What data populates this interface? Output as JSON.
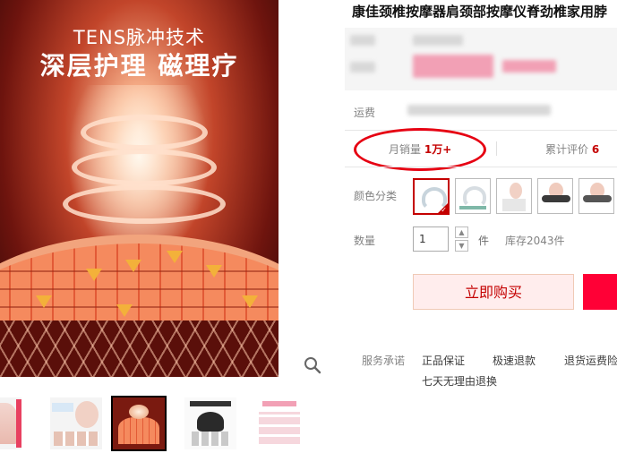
{
  "product": {
    "title": "康佳颈椎按摩器肩颈部按摩仪脊劲椎家用脖",
    "image_headline": "TENS脉冲技术",
    "image_subheadline": "深层护理 磁理疗"
  },
  "info": {
    "shipping_label": "运费",
    "monthly_sales_label": "月销量",
    "monthly_sales_value": "1万+",
    "total_reviews_label": "累计评价",
    "total_reviews_value": "6"
  },
  "options": {
    "color_label": "颜色分类",
    "quantity_label": "数量",
    "quantity_value": "1",
    "unit": "件",
    "stock_text": "库存2043件"
  },
  "actions": {
    "buy_now": "立即购买"
  },
  "services": {
    "label": "服务承诺",
    "items": [
      "正品保证",
      "极速退款",
      "退货运费险",
      "七天无理由退换"
    ]
  },
  "colors": {
    "accent": "#c40000",
    "cart_button": "#ff0036",
    "highlight_circle": "#e60012"
  }
}
